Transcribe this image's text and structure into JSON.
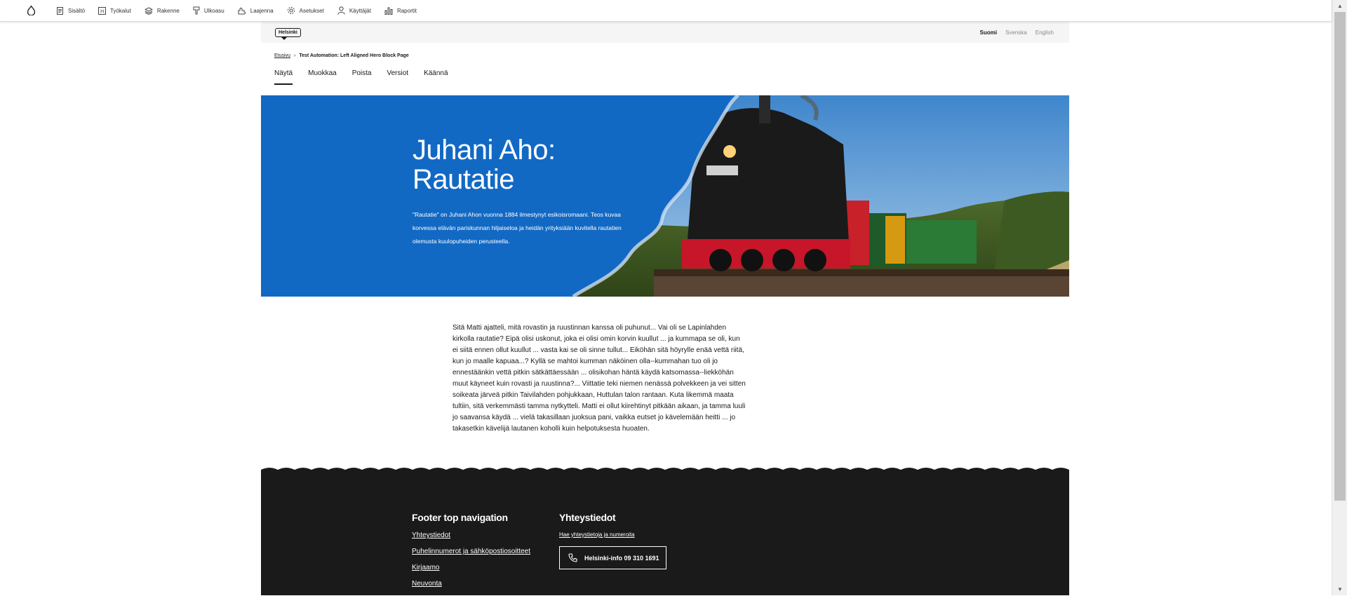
{
  "toolbar": {
    "items": [
      {
        "label": "Sisältö",
        "icon": "document-icon"
      },
      {
        "label": "Työkalut",
        "icon": "toolbox-icon"
      },
      {
        "label": "Rakenne",
        "icon": "layers-icon"
      },
      {
        "label": "Ulkoasu",
        "icon": "brush-icon"
      },
      {
        "label": "Laajenna",
        "icon": "puzzle-icon"
      },
      {
        "label": "Asetukset",
        "icon": "gear-icon"
      },
      {
        "label": "Käyttäjät",
        "icon": "user-icon"
      },
      {
        "label": "Raportit",
        "icon": "bar-chart-icon"
      }
    ]
  },
  "header": {
    "logo_text": "Helsinki",
    "languages": [
      {
        "label": "Suomi",
        "active": true
      },
      {
        "label": "Svenska",
        "active": false
      },
      {
        "label": "English",
        "active": false
      }
    ]
  },
  "breadcrumb": {
    "home": "Etusivu",
    "current": "Test Automation: Left Aligned Hero Block Page"
  },
  "tabs": [
    "Näytä",
    "Muokkaa",
    "Poista",
    "Versiot",
    "Käännä"
  ],
  "hero": {
    "title": "Juhani Aho: Rautatie",
    "description": "\"Rautatie\" on Juhani Ahon vuonna 1884 ilmestynyt esikoisromaani. Teos kuvaa korvessa elävän pariskunnan hiljaiseloa ja heidän yrityksiään kuvitella rautatien olemusta kuulopuheiden perusteella.",
    "background_color": "#1269c4"
  },
  "body": {
    "text": "Sitä Matti ajatteli, mitä rovastin ja ruustinnan kanssa oli puhunut... Vai oli se Lapinlahden kirkolla rautatie? Eipä olisi uskonut, joka ei olisi omin korvin kuullut ... ja kummapa se oli, kun ei siitä ennen ollut kuullut ... vasta kai se oli sinne tullut... Eiköhän sitä höyrylle enää vettä riitä, kun jo maalle kapuaa...? Kyllä se mahtoi kumman näköinen olla--kummahan tuo oli jo ennestäänkin vettä pitkin sätkättäessään ... olisikohan häntä käydä katsomassa--liekköhän muut käyneet kuin rovasti ja ruustinna?... Viittatie teki niemen nenässä polvekkeen ja vei sitten soikeata järveä pitkin Taivilahden pohjukkaan, Huttulan talon rantaan. Kuta likemmä maata tultiin, sitä verkemmästi tamma nytkytteli. Matti ei ollut kiirehtinyt pitkään aikaan, ja tamma luuli jo saavansa käydä ... vielä takasillaan juoksua pani, vaikka eutset jo kävelemään heitti ... jo takasetkin kävelijä lautanen koholli kuin helpotuksesta huoaten."
  },
  "footer": {
    "nav_heading": "Footer top navigation",
    "nav_links": [
      "Yhteystiedot",
      "Puhelinnumerot ja sähköpostiosoitteet",
      "Kirjaamo",
      "Neuvonta"
    ],
    "contact_heading": "Yhteystiedot",
    "contact_link": "Hae yhteystietoja ja numeroita",
    "phone_button": "Helsinki-info 09 310 1691"
  }
}
